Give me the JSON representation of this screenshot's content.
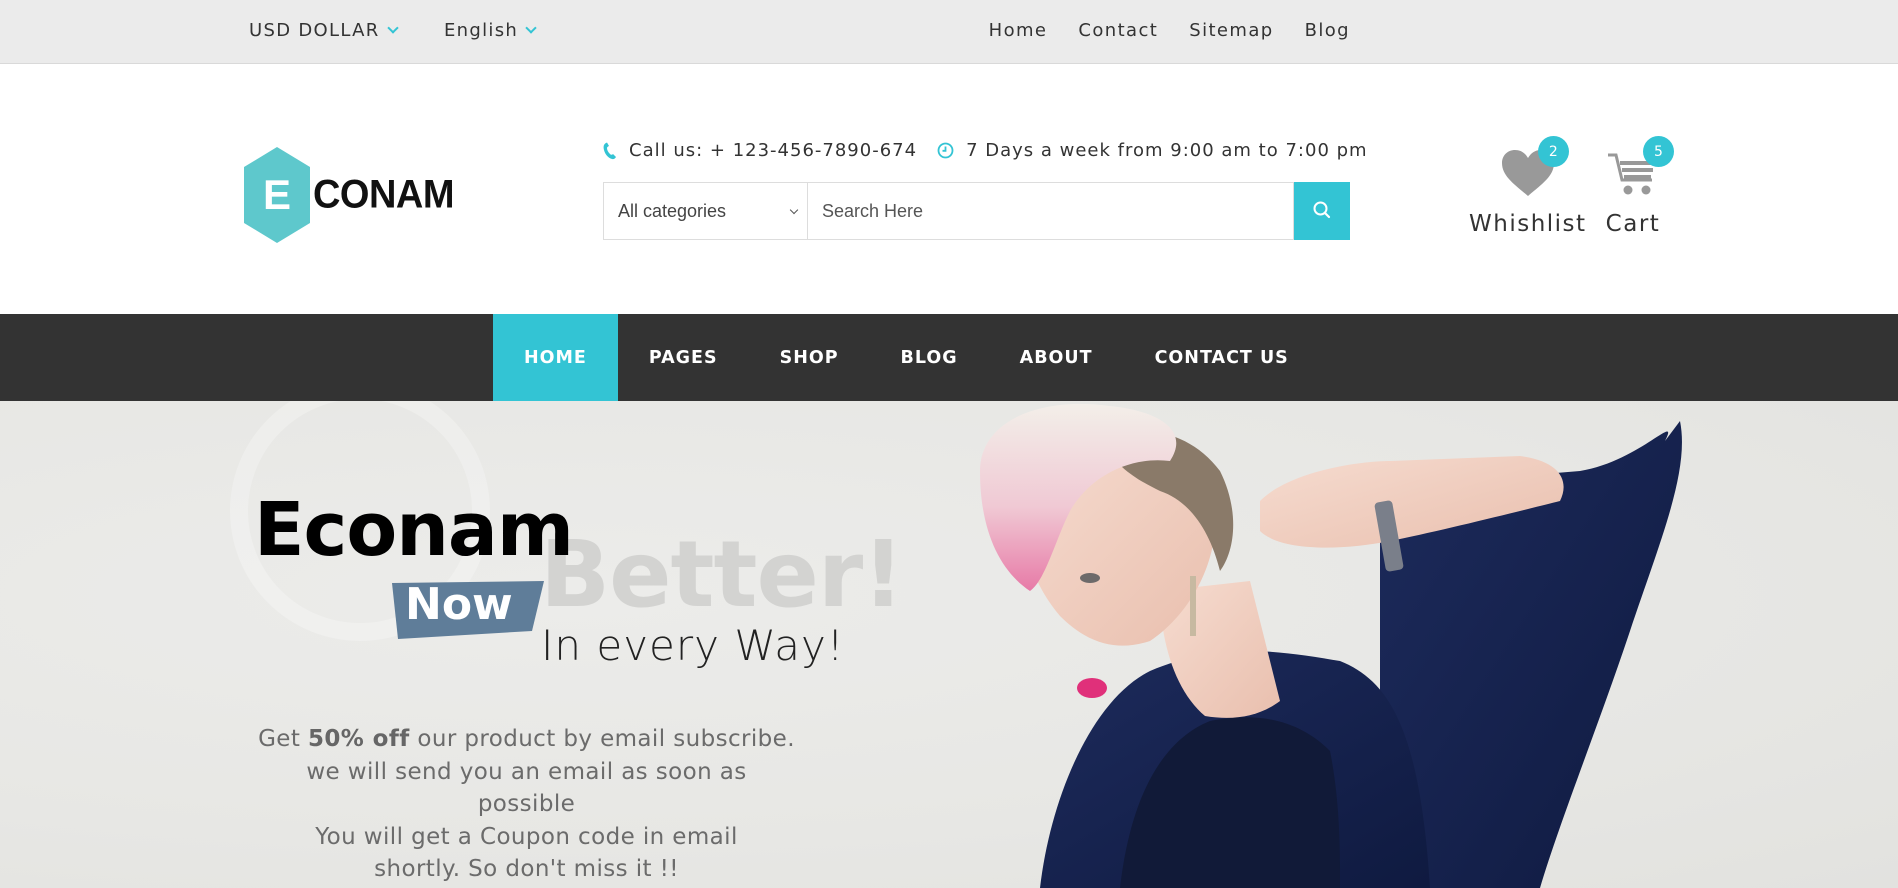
{
  "topbar": {
    "currency": "USD DOLLAR",
    "language": "English",
    "links": [
      "Home",
      "Contact",
      "Sitemap",
      "Blog"
    ]
  },
  "header": {
    "logo": {
      "badge_letter": "E",
      "wordmark": "CONAM"
    },
    "call_text": "Call us: + 123-456-7890-674",
    "hours_text": "7 Days a week from 9:00 am to 7:00 pm",
    "search": {
      "category_selected": "All categories",
      "placeholder": "Search Here",
      "value": ""
    },
    "wishlist": {
      "label": "Whishlist",
      "count": "2",
      "icon": "heart-icon"
    },
    "cart": {
      "label": "Cart",
      "count": "5",
      "icon": "cart-icon"
    }
  },
  "nav": {
    "items": [
      "HOME",
      "PAGES",
      "SHOP",
      "BLOG",
      "ABOUT",
      "CONTACT US"
    ],
    "active": "HOME"
  },
  "hero": {
    "title": "Econam",
    "ghost_word": "Better!",
    "tag": "Now",
    "subtitle": "In every Way!",
    "desc_prefix": "Get ",
    "desc_bold": "50% off",
    "desc_line1_rest": " our product by email subscribe.",
    "desc_line2": "we will send you an email as soon as possible",
    "desc_line3": "You will get a Coupon code in email",
    "desc_line4": "shortly. So don't miss it !!"
  },
  "colors": {
    "accent": "#33c4d4",
    "nav_bg": "#333333",
    "topbar_bg": "#ebebeb",
    "tag_bg": "#5f7d99",
    "logo_hex": "#5ec8cc"
  }
}
